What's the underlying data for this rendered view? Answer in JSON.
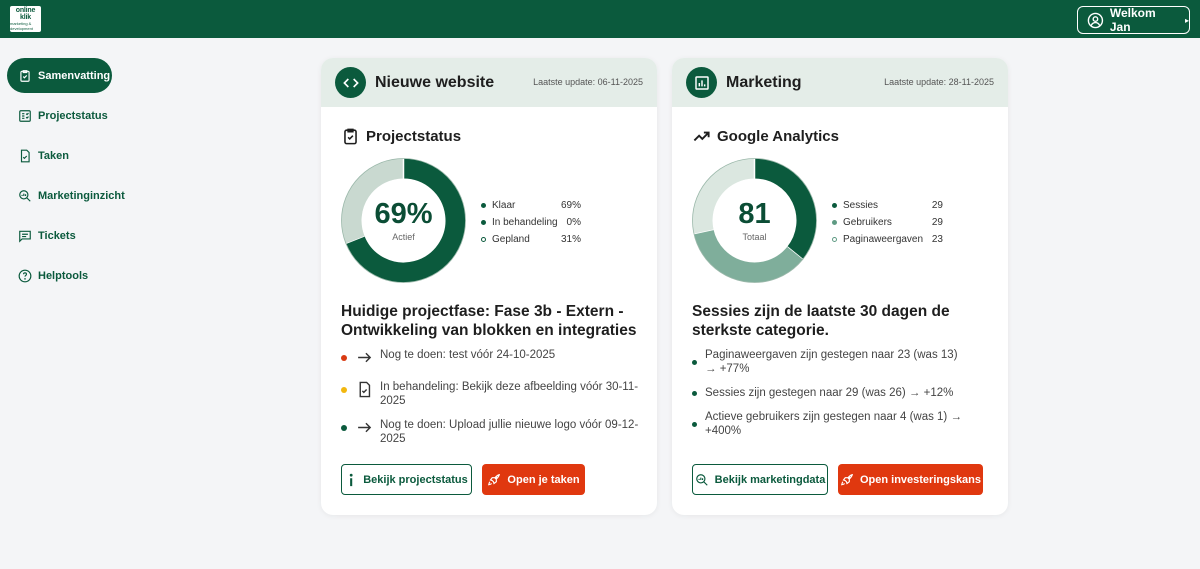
{
  "header": {
    "logo_text_top": "online",
    "logo_text_mid": "klik",
    "logo_text_small": "marketing & development",
    "welcome_label": "Welkom Jan"
  },
  "sidebar": {
    "items": [
      {
        "label": "Samenvatting",
        "icon": "clipboard-check-icon",
        "active": true
      },
      {
        "label": "Projectstatus",
        "icon": "checklist-icon",
        "active": false
      },
      {
        "label": "Taken",
        "icon": "task-file-icon",
        "active": false
      },
      {
        "label": "Marketinginzicht",
        "icon": "search-analytics-icon",
        "active": false
      },
      {
        "label": "Tickets",
        "icon": "chat-icon",
        "active": false
      },
      {
        "label": "Helptools",
        "icon": "help-circle-icon",
        "active": false
      }
    ]
  },
  "project_card": {
    "title": "Nieuwe website",
    "updated": "Laatste update: 06-11-2025",
    "section_title": "Projectstatus",
    "donut_value": "69%",
    "donut_label": "Actief",
    "legend": [
      {
        "label": "Klaar",
        "value": "69%",
        "fraction": 0.69,
        "color": "#0b5a3d"
      },
      {
        "label": "In behandeling",
        "value": "0%",
        "fraction": 0.0,
        "color": "#0b5a3d"
      },
      {
        "label": "Gepland",
        "value": "31%",
        "fraction": 0.31,
        "color": "#c9d9d0"
      }
    ],
    "phase": "Huidige projectfase: Fase 3b - Extern - Ontwikkeling van blokken en integraties",
    "tasks": [
      {
        "text": "Nog te doen: test vóór 24-10-2025",
        "dot_color": "#d93a12",
        "icon": "arrow-right-icon"
      },
      {
        "text": "In behandeling: Bekijk deze afbeelding vóór 30-11-2025",
        "dot_color": "#f2b70f",
        "icon": "document-check-icon"
      },
      {
        "text": "Nog te doen: Upload jullie nieuwe logo vóór 09-12-2025",
        "dot_color": "#0b5a3d",
        "icon": "arrow-right-icon"
      }
    ],
    "btn_secondary": "Bekijk projectstatus",
    "btn_primary": "Open je taken"
  },
  "marketing_card": {
    "title": "Marketing",
    "updated": "Laatste update: 28-11-2025",
    "section_title": "Google Analytics",
    "donut_value": "81",
    "donut_label": "Totaal",
    "legend": [
      {
        "label": "Sessies",
        "value": "29",
        "count": 29,
        "color": "#0b5a3d"
      },
      {
        "label": "Gebruikers",
        "value": "29",
        "count": 29,
        "color": "#7fae9b"
      },
      {
        "label": "Paginaweergaven",
        "value": "23",
        "count": 23,
        "color": "#dbe7e0"
      }
    ],
    "summary": "Sessies zijn de laatste 30 dagen de sterkste categorie.",
    "bullets": [
      "Paginaweergaven zijn gestegen naar 23 (was 13) → +77%",
      "Sessies zijn gestegen naar 29 (was 26) → +12%",
      "Actieve gebruikers zijn gestegen naar 4 (was 1) → +400%"
    ],
    "btn_secondary": "Bekijk marketingdata",
    "btn_primary": "Open investeringskans"
  },
  "colors": {
    "brand": "#0b5a3d",
    "accent": "#e0380f"
  }
}
